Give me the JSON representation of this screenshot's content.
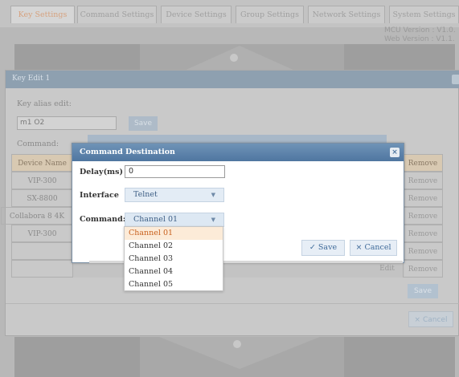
{
  "tabs": [
    {
      "label": "Key Settings",
      "active": true
    },
    {
      "label": "Command Settings",
      "active": false
    },
    {
      "label": "Device Settings",
      "active": false
    },
    {
      "label": "Group Settings",
      "active": false
    },
    {
      "label": "Network Settings",
      "active": false
    },
    {
      "label": "System Settings",
      "active": false
    }
  ],
  "version": {
    "mcu": "MCU Version : V1.0.",
    "web": "Web Version : V1.1."
  },
  "key_edit": {
    "title": "Key Edit 1",
    "alias_label": "Key alias edit:",
    "alias_value": "m1 O2",
    "save_label": "Save",
    "command_label": "Command:",
    "cancel_label": "× Cancel",
    "table": {
      "header": "Device Name",
      "rows": [
        "VIP-300",
        "SX-8800",
        "Collabora 8 4K",
        "VIP-300",
        "",
        ""
      ],
      "remove_header": "Remove",
      "remove_labels": [
        "Remove",
        "Remove",
        "Remove",
        "Remove",
        "Remove",
        "Remove"
      ],
      "edit_label": "Edit",
      "save_label": "Save"
    }
  },
  "dest_dialog": {
    "title": "Command Destination",
    "delay_label": "Delay(ms)",
    "delay_value": "0",
    "interface_label": "Interface",
    "interface_value": "Telnet",
    "command_label": "Command:",
    "command_value": "Channel 01",
    "save_label": "✓ Save",
    "cancel_label": "× Cancel",
    "options": [
      "Channel 01",
      "Channel 02",
      "Channel 03",
      "Channel 04",
      "Channel 05"
    ],
    "selected_index": 0
  },
  "colors": {
    "active_tab_text": "#d6a27f",
    "dialog_header": "#5a7fa8",
    "accent_blue": "#3e6a99",
    "selected_option_bg": "#fcebd8",
    "selected_option_text": "#c8611e"
  }
}
